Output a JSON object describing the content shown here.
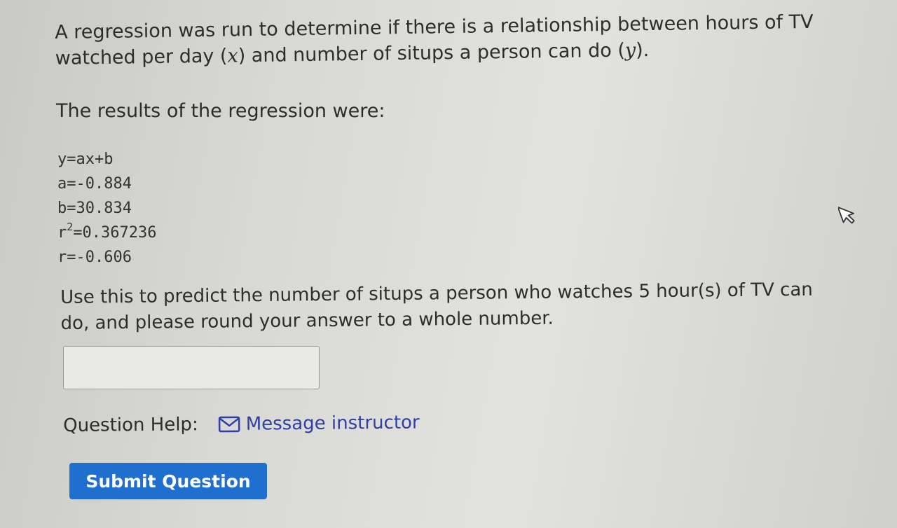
{
  "question": {
    "intro_part1": "A regression was run to determine if there is a relationship between hours of TV watched per day (",
    "intro_var_x": "x",
    "intro_part2": ") and number of situps a person can do (",
    "intro_var_y": "y",
    "intro_part3": ").",
    "results_heading": "The results of the regression were:",
    "results": {
      "equation": "y=ax+b",
      "a_line": "a=-0.884",
      "b_line": "b=30.834",
      "r2_prefix": "r",
      "r2_exponent": "2",
      "r2_value": "=0.367236",
      "r_line": "r=-0.606"
    },
    "prompt": "Use this to predict the number of situps a person who watches 5 hour(s) of TV can do, and please round your answer to a whole number."
  },
  "answer": {
    "value": "",
    "placeholder": ""
  },
  "help": {
    "label": "Question Help:",
    "icon": "envelope-icon",
    "link_label": "Message instructor"
  },
  "submit": {
    "label": "Submit Question"
  },
  "colors": {
    "link": "#2f3fa5",
    "button": "#1f6fcf",
    "text": "#2d2d2d"
  },
  "cursor": {
    "icon": "mouse-pointer-icon"
  }
}
